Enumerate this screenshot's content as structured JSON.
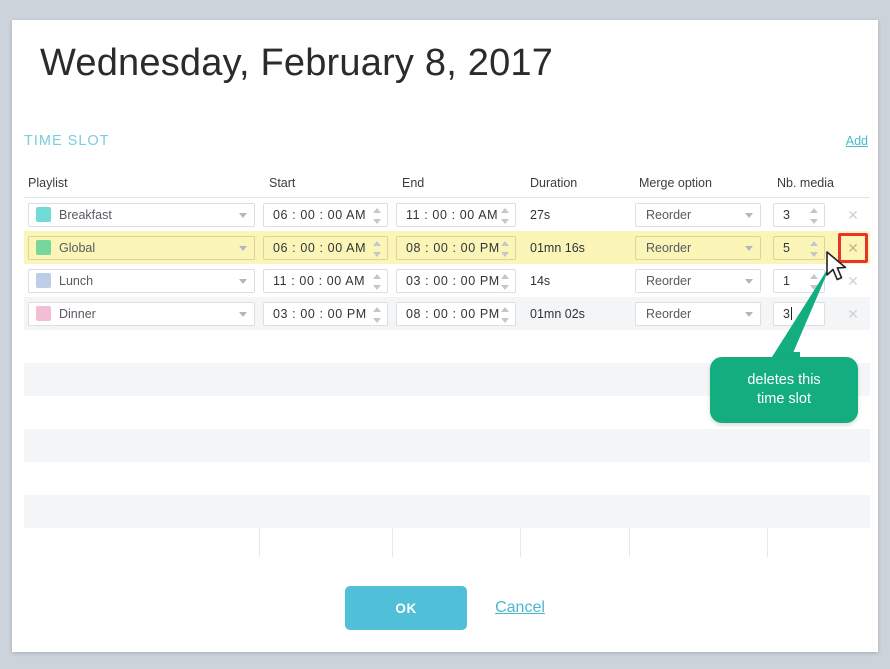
{
  "dialog": {
    "title": "Wednesday, February 8, 2017",
    "section_label": "TIME SLOT",
    "add_label": "Add"
  },
  "table": {
    "columns": [
      {
        "key": "playlist",
        "label": "Playlist"
      },
      {
        "key": "start",
        "label": "Start"
      },
      {
        "key": "end",
        "label": "End"
      },
      {
        "key": "duration",
        "label": "Duration"
      },
      {
        "key": "merge",
        "label": "Merge option"
      },
      {
        "key": "nbmedia",
        "label": "Nb. media"
      }
    ],
    "rows": [
      {
        "playlist": "Breakfast",
        "color": "#6fdcd8",
        "start": "06 : 00 : 00 AM",
        "end": "11 : 00 : 00 AM",
        "duration": "27s",
        "merge": "Reorder",
        "nbmedia": "3",
        "selected": false,
        "delete_label": "✕"
      },
      {
        "playlist": "Global",
        "color": "#77d69b",
        "start": "06 : 00 : 00 AM",
        "end": "08 : 00 : 00 PM",
        "duration": "01mn 16s",
        "merge": "Reorder",
        "nbmedia": "5",
        "selected": true,
        "delete_label": "✕"
      },
      {
        "playlist": "Lunch",
        "color": "#bccde8",
        "start": "11 : 00 : 00 AM",
        "end": "03 : 00 : 00 PM",
        "duration": "14s",
        "merge": "Reorder",
        "nbmedia": "1",
        "selected": false,
        "delete_label": "✕"
      },
      {
        "playlist": "Dinner",
        "color": "#f3bdd6",
        "start": "03 : 00 : 00 PM",
        "end": "08 : 00 : 00 PM",
        "duration": "01mn 02s",
        "merge": "Reorder",
        "nbmedia": "3",
        "selected": false,
        "delete_label": "✕",
        "editing": true
      }
    ],
    "empty_row_count": 6
  },
  "annotation": {
    "line1": "deletes this",
    "line2": "time slot",
    "color": "#13ad80",
    "highlight_color": "#e8352b"
  },
  "footer": {
    "ok_label": "OK",
    "cancel_label": "Cancel",
    "ok_color": "#4fc0d8"
  },
  "theme": {
    "accent": "#4ab8cd",
    "section": "#79cede",
    "selected_row": "#fbf6b8",
    "page_background": "#ccd3db"
  }
}
